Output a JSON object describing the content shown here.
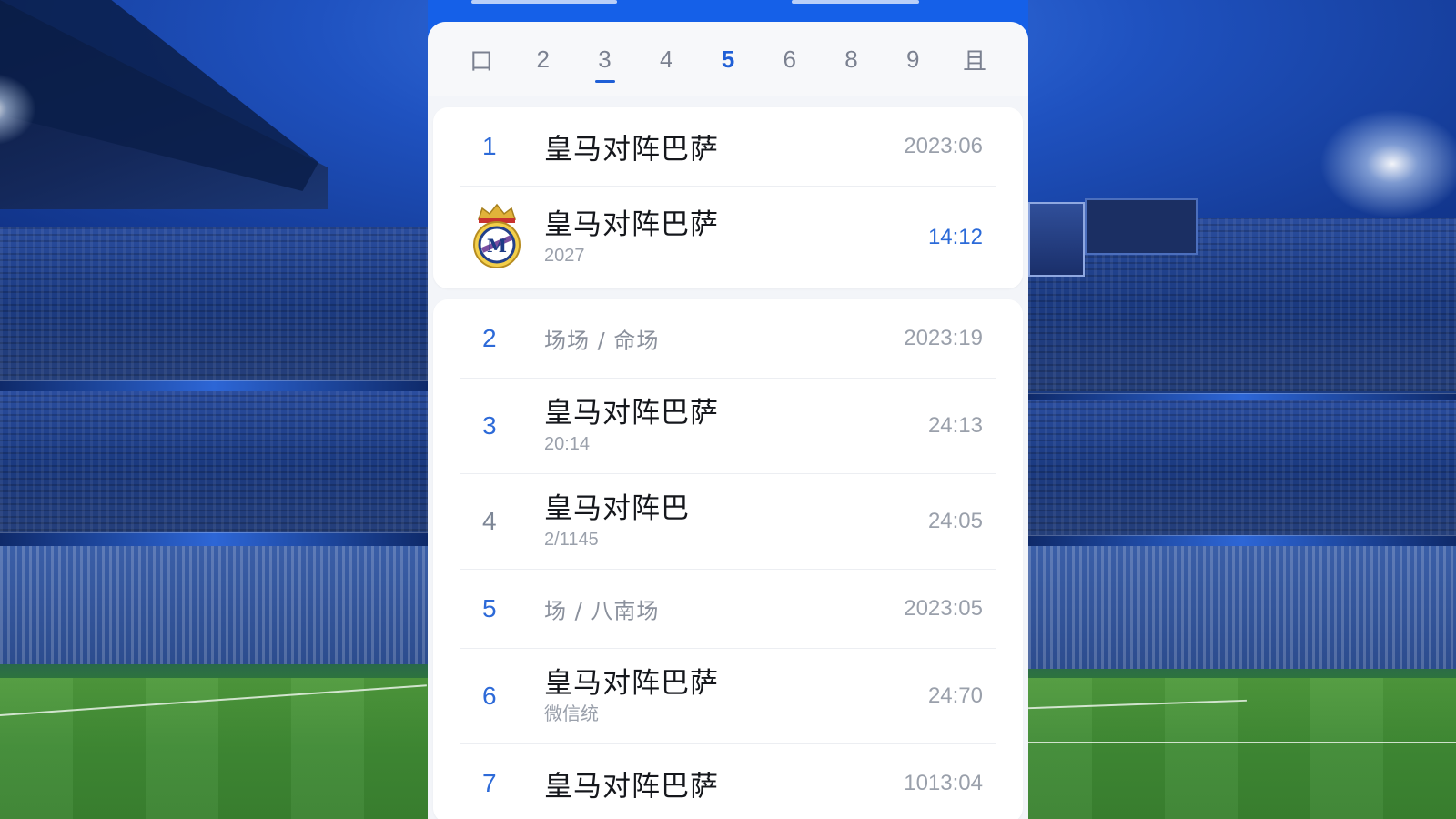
{
  "tabs": [
    {
      "label": "口",
      "active": false
    },
    {
      "label": "2",
      "active": false
    },
    {
      "label": "3",
      "active": false,
      "underlined": true
    },
    {
      "label": "4",
      "active": false
    },
    {
      "label": "5",
      "active": true
    },
    {
      "label": "6",
      "active": false
    },
    {
      "label": "8",
      "active": false
    },
    {
      "label": "9",
      "active": false
    },
    {
      "label": "且",
      "active": false
    }
  ],
  "list": {
    "group1": [
      {
        "rank": "1",
        "title": "皇马对阵巴萨",
        "time": "2023:06"
      },
      {
        "rank": "",
        "title": "皇马对阵巴萨",
        "subtitle": "2027",
        "time": "14:12",
        "icon": "real-madrid-crest-icon"
      }
    ],
    "group2": [
      {
        "rank": "2",
        "title": "场场 / 命场",
        "time": "2023:19"
      },
      {
        "rank": "3",
        "title": "皇马对阵巴萨",
        "subtitle": "20:14",
        "time": "24:13"
      },
      {
        "rank": "4",
        "title": "皇马对阵巴",
        "subtitle": "2/1145",
        "time": "24:05"
      },
      {
        "rank": "5",
        "title": "场 / 八南场",
        "time": "2023:05"
      },
      {
        "rank": "6",
        "title": "皇马对阵巴萨",
        "subtitle": "微信统",
        "time": "24:70"
      },
      {
        "rank": "7",
        "title": "皇马对阵巴萨",
        "time": "1013:04"
      }
    ]
  },
  "colors": {
    "accent": "#1f5fd6",
    "header": "#1560e8",
    "card": "#f3f5f9",
    "rank": "#2d6ad8"
  }
}
